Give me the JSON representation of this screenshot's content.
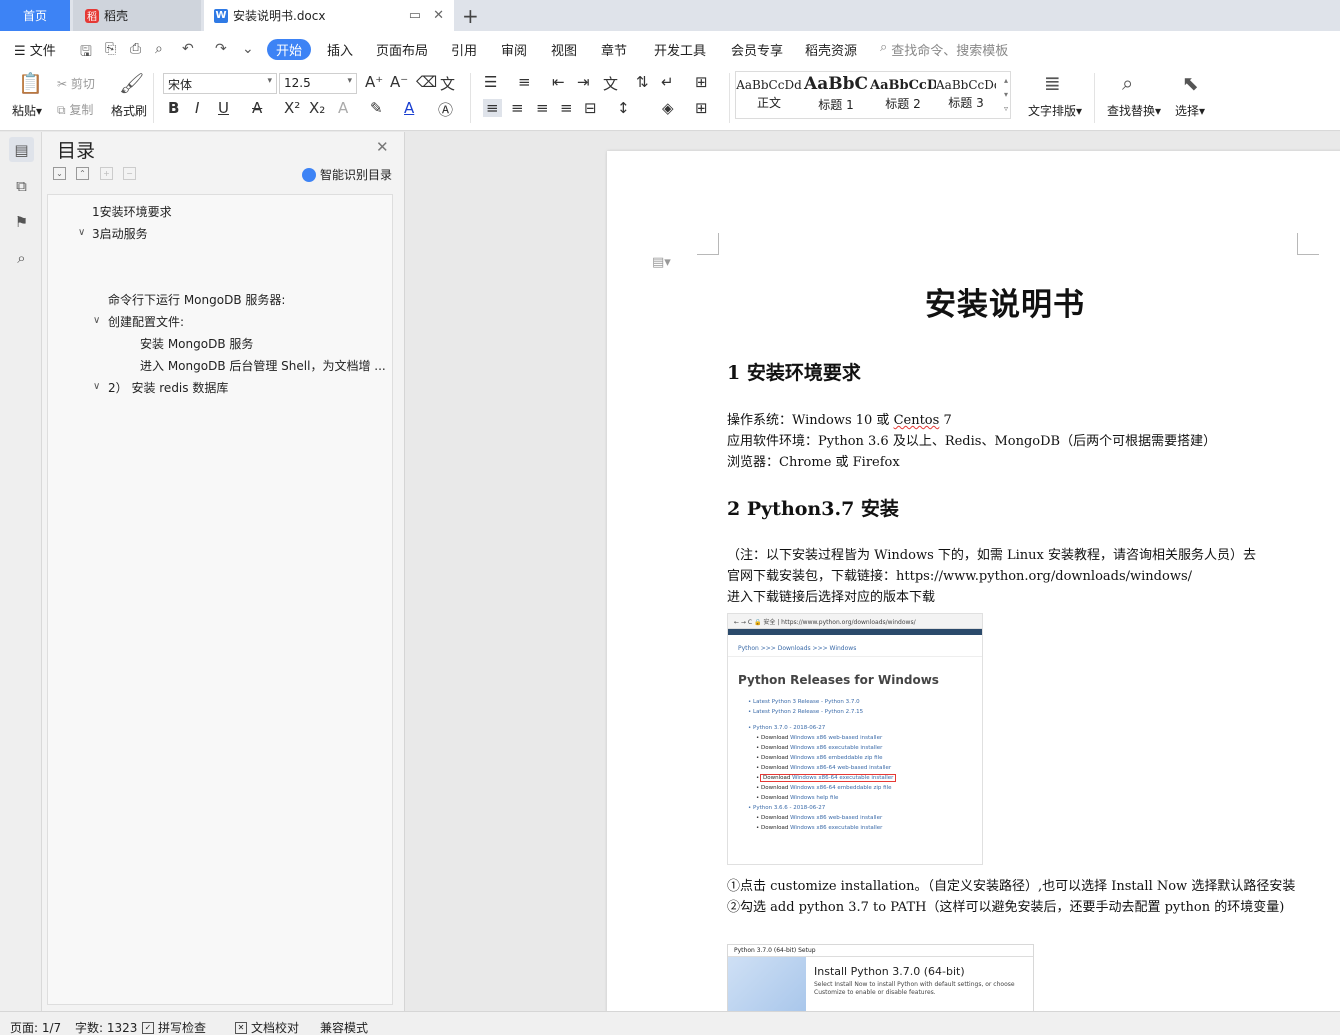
{
  "tabs": {
    "home": "首页",
    "daoke": "稻壳",
    "doc": "安装说明书.docx",
    "new_tab": "+"
  },
  "menubar": {
    "file": "文件",
    "items": [
      "开始",
      "插入",
      "页面布局",
      "引用",
      "审阅",
      "视图",
      "章节",
      "开发工具",
      "会员专享",
      "稻壳资源"
    ],
    "search_placeholder": "查找命令、搜索模板"
  },
  "ribbon": {
    "paste": "粘贴",
    "cut": "剪切",
    "copy": "复制",
    "format_painter": "格式刷",
    "font_name": "宋体",
    "font_size": "12.5",
    "styles": [
      {
        "preview": "AaBbCcDd",
        "name": "正文"
      },
      {
        "preview": "AaBbC",
        "name": "标题 1"
      },
      {
        "preview": "AaBbCcD",
        "name": "标题 2"
      },
      {
        "preview": "AaBbCcDd",
        "name": "标题 3"
      }
    ],
    "text_layout": "文字排版",
    "find_replace": "查找替换",
    "select": "选择"
  },
  "toc": {
    "title": "目录",
    "smart": "智能识别目录",
    "items": [
      "1安装环境要求",
      "3启动服务",
      "命令行下运行 MongoDB 服务器:",
      "创建配置文件:",
      "安装 MongoDB 服务",
      "进入 MongoDB 后台管理 Shell，为文档增 ...",
      "2）  安装 redis 数据库"
    ]
  },
  "document": {
    "title": "安装说明书",
    "h1_1": "1  安装环境要求",
    "os_label": "操作系统：Windows 10 或 ",
    "os_centos": "Centos",
    "os_ver": " 7",
    "env": "应用软件环境：Python 3.6 及以上、Redis、MongoDB（后两个可根据需要搭建）",
    "browser": "浏览器：Chrome 或 Firefox",
    "h1_2": "2 Python3.7  安装",
    "note": "（注：以下安装过程皆为 Windows 下的，如需 Linux 安装教程，请咨询相关服务人员）去",
    "download": "官网下载安装包，下载链接：https://www.python.org/downloads/windows/",
    "choose": "进入下载链接后选择对应的版本下载",
    "step1": "①点击 customize installation。（自定义安装路径）,也可以选择 Install Now 选择默认路径安装",
    "step2": "②勾选 add python 3.7 to PATH（这样可以避免安装后，还要手动去配置 python 的环境变量)",
    "shot1": {
      "url": "← → C  🔒 安全 | https://www.python.org/downloads/windows/",
      "breadcrumb": "Python  >>> Downloads  >>> Windows",
      "heading": "Python Releases for Windows",
      "latest3": "Latest Python 3 Release - Python 3.7.0",
      "latest2": "Latest Python 2 Release - Python 2.7.15",
      "rel370": "Python 3.7.0 - 2018-06-27",
      "dl": [
        "Windows x86 web-based installer",
        "Windows x86 executable installer",
        "Windows x86 embeddable zip file",
        "Windows x86-64 web-based installer",
        "Windows x86-64 executable installer",
        "Windows x86-64 embeddable zip file",
        "Windows help file"
      ],
      "rel366": "Python 3.6.6 - 2018-06-27",
      "dl2": [
        "Windows x86 web-based installer",
        "Windows x86 executable installer"
      ],
      "download_word": "Download"
    },
    "shot2": {
      "window_title": "Python 3.7.0 (64-bit) Setup",
      "heading": "Install Python 3.7.0 (64-bit)",
      "sub": "Select Install Now to install Python with default settings, or choose Customize to enable or disable features."
    }
  },
  "status": {
    "page": "页面: 1/7",
    "words": "字数: 1323",
    "spell": "拼写检查",
    "proof": "文档校对",
    "compat": "兼容模式"
  },
  "colors": {
    "accent": "#3d83f5",
    "error_underline": "#e53935"
  }
}
